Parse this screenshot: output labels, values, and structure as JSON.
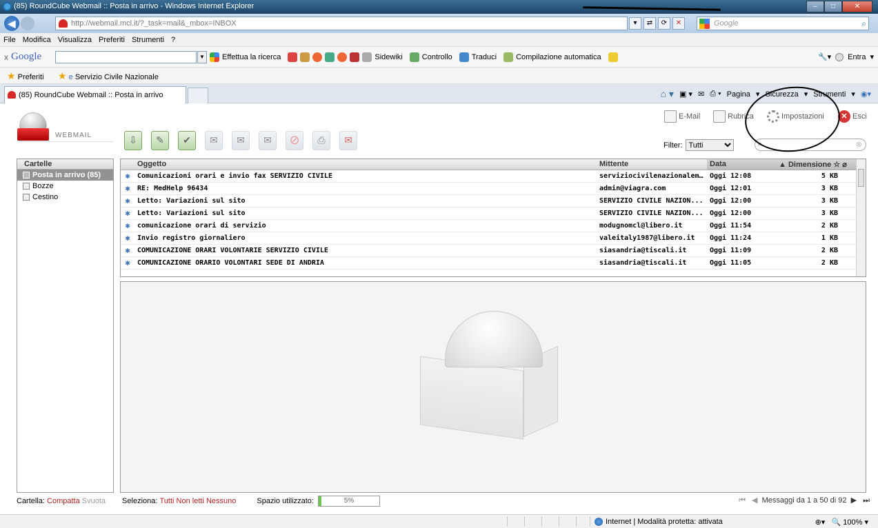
{
  "window": {
    "title": "(85) RoundCube Webmail :: Posta in arrivo - Windows Internet Explorer"
  },
  "browser": {
    "url": "http://webmail.mcl.it/?_task=mail&_mbox=INBOX",
    "search_placeholder": "Google",
    "menu": [
      "File",
      "Modifica",
      "Visualizza",
      "Preferiti",
      "Strumenti",
      "?"
    ],
    "google_toolbar": {
      "logo": "Google",
      "search_label": "Effettua la ricerca",
      "sidewiki": "Sidewiki",
      "controllo": "Controllo",
      "traduci": "Traduci",
      "compilazione": "Compilazione automatica",
      "entra": "Entra"
    },
    "favorites": {
      "label": "Preferiti",
      "item": "Servizio Civile Nazionale"
    },
    "tab_title": "(85) RoundCube Webmail :: Posta in arrivo",
    "command_bar": [
      "Pagina",
      "Sicurezza",
      "Strumenti"
    ]
  },
  "app": {
    "logo_text": "WEBMAIL",
    "nav": {
      "email": "E-Mail",
      "rubrica": "Rubrica",
      "impostazioni": "Impostazioni",
      "esci": "Esci"
    },
    "filter_label": "Filter:",
    "filter_value": "Tutti",
    "folders_header": "Cartelle",
    "folders": [
      {
        "name": "Posta in arrivo (85)",
        "selected": true
      },
      {
        "name": "Bozze",
        "selected": false
      },
      {
        "name": "Cestino",
        "selected": false
      }
    ],
    "columns": {
      "subject": "Oggetto",
      "from": "Mittente",
      "date": "Data",
      "size": "Dimensione"
    },
    "messages": [
      {
        "subject": "Comunicazioni orari e invio fax SERVIZIO CIVILE",
        "from": "serviziocivilenazionalem...",
        "date": "Oggi 12:08",
        "size": "5 KB"
      },
      {
        "subject": "RE: MedHelp 96434",
        "from": "admin@viagra.com",
        "date": "Oggi 12:01",
        "size": "3 KB"
      },
      {
        "subject": "Letto: Variazioni sul sito",
        "from": "SERVIZIO CIVILE NAZION...",
        "date": "Oggi 12:00",
        "size": "3 KB"
      },
      {
        "subject": "Letto: Variazioni sul sito",
        "from": "SERVIZIO CIVILE NAZION...",
        "date": "Oggi 12:00",
        "size": "3 KB"
      },
      {
        "subject": "comunicazione orari di servizio",
        "from": "modugnomcl@libero.it",
        "date": "Oggi 11:54",
        "size": "2 KB"
      },
      {
        "subject": "Invio registro giornaliero",
        "from": "valeitaly1987@libero.it",
        "date": "Oggi 11:24",
        "size": "1 KB"
      },
      {
        "subject": "COMUNICAZIONE ORARI VOLONTARIE SERVIZIO CIVILE",
        "from": "siasandria@tiscali.it",
        "date": "Oggi 11:09",
        "size": "2 KB"
      },
      {
        "subject": "COMUNICAZIONE ORARIO VOLONTARI SEDE DI ANDRIA",
        "from": "siasandria@tiscali.it",
        "date": "Oggi 11:05",
        "size": "2 KB"
      }
    ],
    "footer": {
      "cartella_label": "Cartella:",
      "compatta": "Compatta",
      "svuota": "Svuota",
      "seleziona_label": "Seleziona:",
      "tutti": "Tutti",
      "non_letti": "Non letti",
      "nessuno": "Nessuno",
      "spazio_label": "Spazio utilizzato:",
      "quota_text": "5%",
      "quota_fraction": 0.05,
      "pager_text": "Messaggi da 1 a 50 di 92"
    }
  },
  "statusbar": {
    "zone": "Internet | Modalità protetta: attivata",
    "zoom": "100%"
  }
}
